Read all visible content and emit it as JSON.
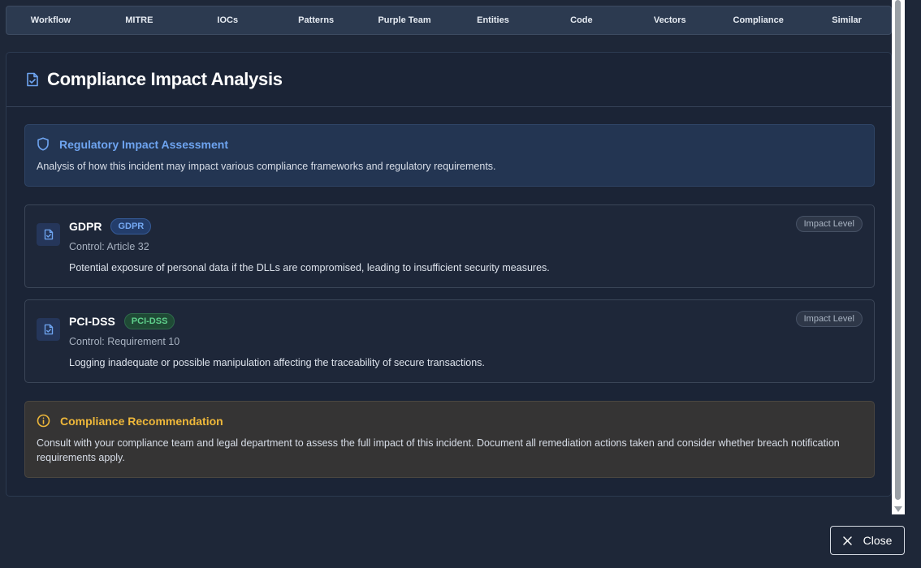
{
  "tabs": [
    "Workflow",
    "MITRE",
    "IOCs",
    "Patterns",
    "Purple Team",
    "Entities",
    "Code",
    "Vectors",
    "Compliance",
    "Similar"
  ],
  "panel": {
    "title": "Compliance Impact Analysis",
    "title_icon": "file-check-icon"
  },
  "regulatory": {
    "title": "Regulatory Impact Assessment",
    "icon": "shield-icon",
    "text": "Analysis of how this incident may impact various compliance frameworks and regulatory requirements."
  },
  "frameworks": [
    {
      "name": "GDPR",
      "badge": "GDPR",
      "badge_color": "#74a8f2",
      "control": "Control: Article 32",
      "description": "Potential exposure of personal data if the DLLs are compromised, leading to insufficient security measures.",
      "impact_label": "Impact Level",
      "icon": "file-check-icon"
    },
    {
      "name": "PCI-DSS",
      "badge": "PCI-DSS",
      "badge_color": "#5fd08c",
      "control": "Control: Requirement 10",
      "description": "Logging inadequate or possible manipulation affecting the traceability of secure transactions.",
      "impact_label": "Impact Level",
      "icon": "file-check-icon"
    }
  ],
  "recommendation": {
    "title": "Compliance Recommendation",
    "icon": "info-circle-icon",
    "text": "Consult with your compliance team and legal department to assess the full impact of this incident. Document all remediation actions taken and consider whether breach notification requirements apply."
  },
  "close_button": {
    "label": "Close",
    "icon": "close-icon"
  },
  "colors": {
    "background": "#1e2738",
    "accent_blue": "#6ea4f0",
    "accent_amber": "#efb83a",
    "accent_green": "#5fd08c"
  }
}
